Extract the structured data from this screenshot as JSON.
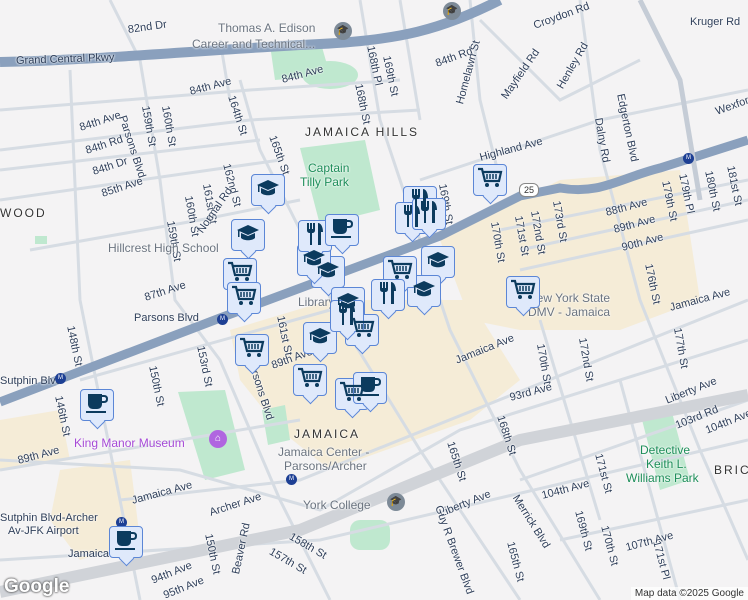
{
  "map": {
    "neighborhoods": [
      "JAMAICA HILLS",
      "JAMAICA",
      "WOOD",
      "BRICK"
    ],
    "pois": {
      "edison": [
        "Thomas A. Edison",
        "Career and Technical..."
      ],
      "hillcrest": "Hillcrest High School",
      "dmv": [
        "New York State",
        "DMV - Jamaica"
      ],
      "library": "Library",
      "york": "York College",
      "king_manor": "King Manor Museum",
      "jamaica_center": [
        "Jamaica Center -",
        "Parsons/Archer"
      ],
      "sutphin_archer": [
        "Sutphin Blvd-Archer",
        "Av-JFK Airport"
      ],
      "jamaica_station": "Jamaica",
      "parsons_station": "Parsons Blvd",
      "sutphin_station": "Sutphin Blvd"
    },
    "parks": {
      "tilly": [
        "Captain",
        "Tilly Park"
      ],
      "keith": [
        "Detective",
        "Keith L.",
        "Williams Park"
      ]
    },
    "streets": [
      "82nd Dr",
      "Grand Central Pkwy",
      "84th Ave",
      "84th Ave",
      "84th Ave",
      "84th Rd",
      "84th Dr",
      "85th Ave",
      "Parsons Blvd",
      "159th St",
      "160th St",
      "164th St",
      "165th St",
      "162nd St",
      "161st St",
      "160th St",
      "159th St",
      "Normal Rd",
      "87th Ave",
      "168th St",
      "169th St",
      "168th Pl",
      "84th Rd",
      "Homelawn St",
      "Croydon Rd",
      "Mayfield Rd",
      "Henley Rd",
      "Kruger Rd",
      "Dalny Rd",
      "Edgerton Blvd",
      "Wexford",
      "Highland Ave",
      "169th St",
      "170th St",
      "171st St",
      "172nd St",
      "173rd St",
      "88th Ave",
      "89th Ave",
      "90th Ave",
      "176th St",
      "179th St",
      "179th Pl",
      "180th St",
      "181st St",
      "Jamaica Ave",
      "148th St",
      "150th St",
      "153rd St",
      "146th St",
      "89th Ave",
      "Jamaica Ave",
      "Archer Ave",
      "150th St",
      "Beaver Rd",
      "158th St",
      "157th St",
      "94th Ave",
      "95th Ave",
      "Jamaica Ave",
      "170th St",
      "172nd St",
      "93rd Ave",
      "177th St",
      "Liberty Ave",
      "103rd Rd",
      "104th Ave",
      "104th Ave",
      "168th St",
      "165th St",
      "Liberty Ave",
      "Merrick Blvd",
      "171st St",
      "169th St",
      "170th St",
      "107th Ave",
      "171st Pl",
      "Guy R Brewer Blvd",
      "165th St",
      "161st St",
      "89th Ave",
      "Parsons Blvd"
    ],
    "route_shield": "25",
    "markers": [
      "education",
      "education",
      "education",
      "education",
      "education",
      "education",
      "education",
      "education",
      "shopping",
      "shopping",
      "shopping",
      "shopping",
      "shopping",
      "shopping",
      "shopping",
      "shopping",
      "shopping",
      "restaurant",
      "restaurant",
      "restaurant",
      "restaurant",
      "restaurant",
      "restaurant",
      "cafe",
      "cafe",
      "cafe",
      "cafe"
    ],
    "logo": "Google",
    "attribution": "Map data ©2025 Google"
  }
}
